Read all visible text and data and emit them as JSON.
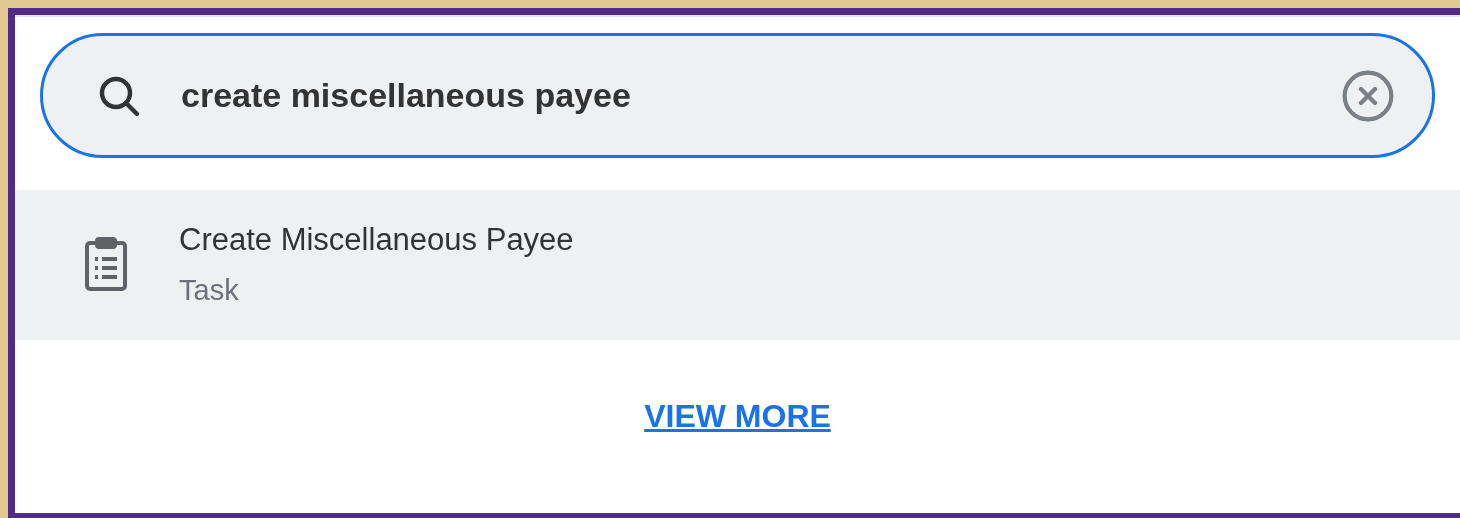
{
  "search": {
    "value": "create miscellaneous payee"
  },
  "results": [
    {
      "title": "Create Miscellaneous Payee",
      "subtitle": "Task",
      "kind": "task",
      "selected": true
    }
  ],
  "view_more": "VIEW MORE"
}
